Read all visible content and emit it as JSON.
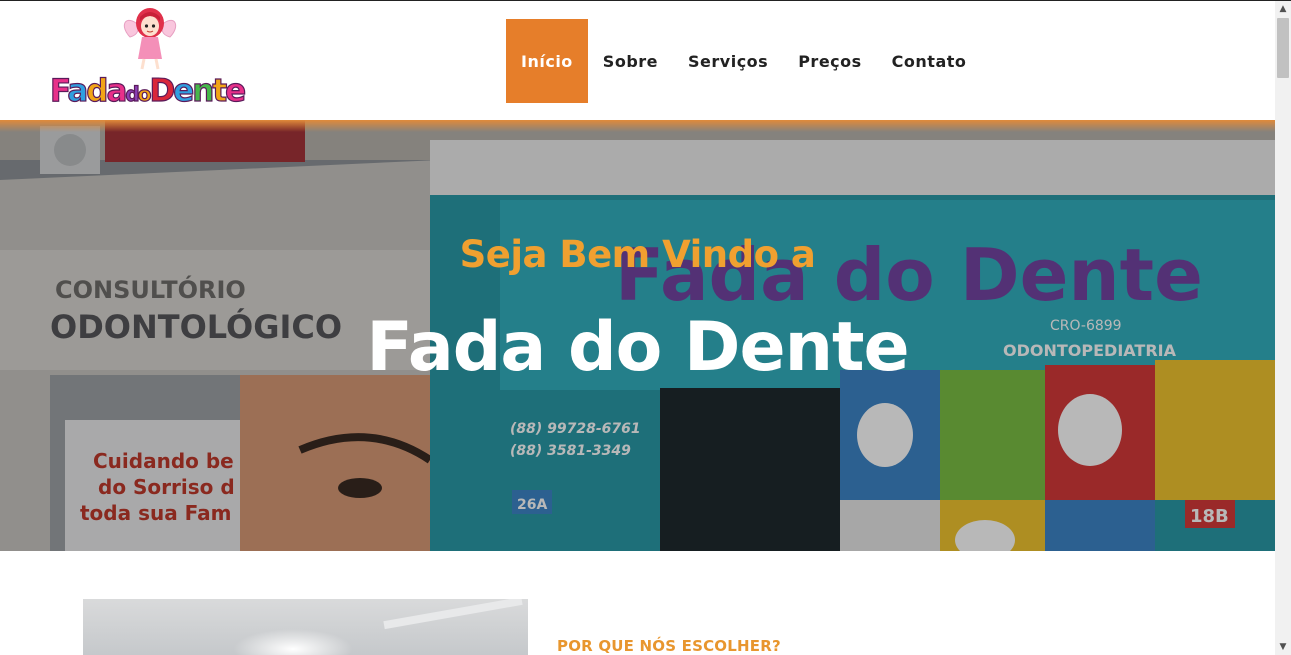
{
  "header": {
    "logo": {
      "letters": [
        {
          "ch": "F",
          "color": "#e8308a"
        },
        {
          "ch": "a",
          "color": "#2f9fe0"
        },
        {
          "ch": "d",
          "color": "#f2a516"
        },
        {
          "ch": "a",
          "color": "#e8308a"
        },
        {
          "ch": "d",
          "color": "#8a3fb5"
        },
        {
          "ch": "o",
          "color": "#f2a516"
        },
        {
          "ch": "D",
          "color": "#d9263a"
        },
        {
          "ch": "e",
          "color": "#2f9fe0"
        },
        {
          "ch": "n",
          "color": "#46b84a"
        },
        {
          "ch": "t",
          "color": "#f2a516"
        },
        {
          "ch": "e",
          "color": "#e8308a"
        }
      ]
    },
    "nav": [
      {
        "label": "Início",
        "active": true
      },
      {
        "label": "Sobre",
        "active": false
      },
      {
        "label": "Serviços",
        "active": false
      },
      {
        "label": "Preços",
        "active": false
      },
      {
        "label": "Contato",
        "active": false
      }
    ]
  },
  "hero": {
    "subtitle": "Seja Bem Vindo a",
    "title": "Fada do Dente",
    "photo": {
      "sign_left_line1": "CONSULTÓRIO",
      "sign_left_line2": "ODONTOLÓGICO",
      "sign_right": "Fada do Dente",
      "cro": "CRO-6899",
      "specialty": "ODONTOPEDIATRIA",
      "phone1": "(88) 99728-6761",
      "phone2": "(88) 3581-3349",
      "window_text": "Cuidando bem do Sorriso de toda sua Família!",
      "number_left": "26A",
      "number_right": "18B"
    }
  },
  "section": {
    "heading": "POR QUE NÓS ESCOLHER?"
  },
  "colors": {
    "accent": "#e67e2a",
    "hero_subtitle": "#f0a030",
    "section_heading": "#e8962e"
  }
}
